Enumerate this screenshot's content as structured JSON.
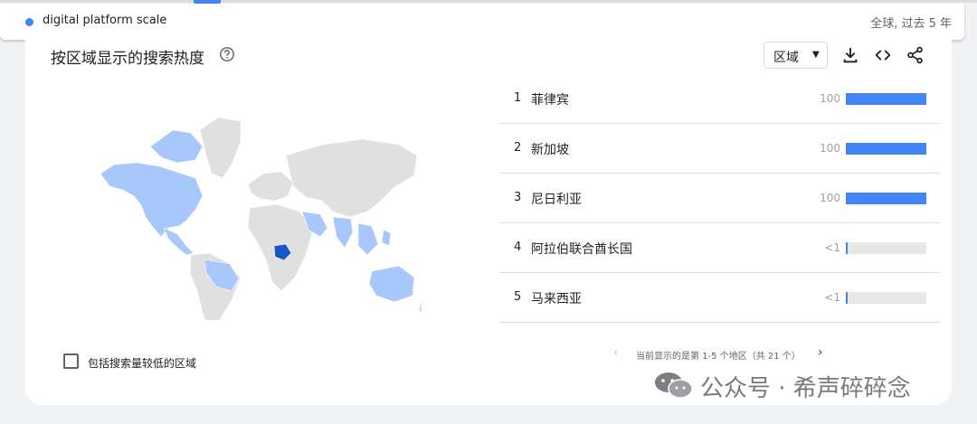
{
  "header": {
    "search_term": "digital platform scale",
    "scope": "全球, 过去 5 年",
    "term_color": "#4285f4"
  },
  "card": {
    "title": "按区域显示的搜索热度",
    "help_icon": "help-circle-icon",
    "region_select": {
      "selected": "区域"
    },
    "tools": [
      "download-icon",
      "embed-code-icon",
      "share-icon"
    ]
  },
  "map": {
    "highlighted_regions": [
      "菲律宾",
      "新加坡",
      "尼日利亚",
      "阿拉伯联合酋长国",
      "马来西亚"
    ],
    "colors": {
      "strong": "#1a56c8",
      "light": "#a8c7fa",
      "none": "#e0e0e0"
    }
  },
  "ranking": {
    "rows": [
      {
        "rank": "1",
        "region": "菲律宾",
        "value_label": "100",
        "level": 100
      },
      {
        "rank": "2",
        "region": "新加坡",
        "value_label": "100",
        "level": 100
      },
      {
        "rank": "3",
        "region": "尼日利亚",
        "value_label": "100",
        "level": 100
      },
      {
        "rank": "4",
        "region": "阿拉伯联合酋长国",
        "value_label": "<1",
        "level": 0.5
      },
      {
        "rank": "5",
        "region": "马来西亚",
        "value_label": "<1",
        "level": 0.5
      }
    ],
    "bar_color": "#4285f4"
  },
  "pager": {
    "text": "当前显示的是第 1-5 个地区（共 21 个）",
    "prev_icon": "chevron-left-icon",
    "next_icon": "chevron-right-icon"
  },
  "options": {
    "include_low_volume_label": "包括搜索量较低的区域",
    "include_low_volume_checked": false
  },
  "watermark": {
    "text": "公众号 · 希声碎碎念",
    "icon": "wechat-icon"
  }
}
